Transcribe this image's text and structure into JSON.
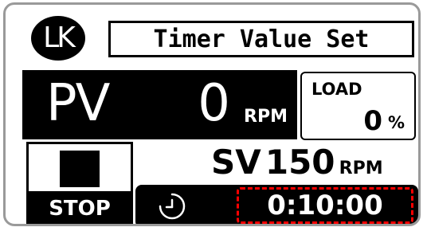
{
  "header": {
    "logo_text": "LK",
    "title": "Timer Value Set"
  },
  "pv": {
    "label": "PV",
    "value": "0",
    "unit": "RPM"
  },
  "load": {
    "label": "LOAD",
    "value": "0",
    "unit": "%"
  },
  "stop_button": {
    "label": "STOP",
    "icon": "stop-square-icon"
  },
  "sv": {
    "label": "SV",
    "value": "150",
    "unit": "RPM"
  },
  "timer": {
    "icon": "clock-icon",
    "value": "0:10:00",
    "highlight_color": "#ff0000"
  }
}
